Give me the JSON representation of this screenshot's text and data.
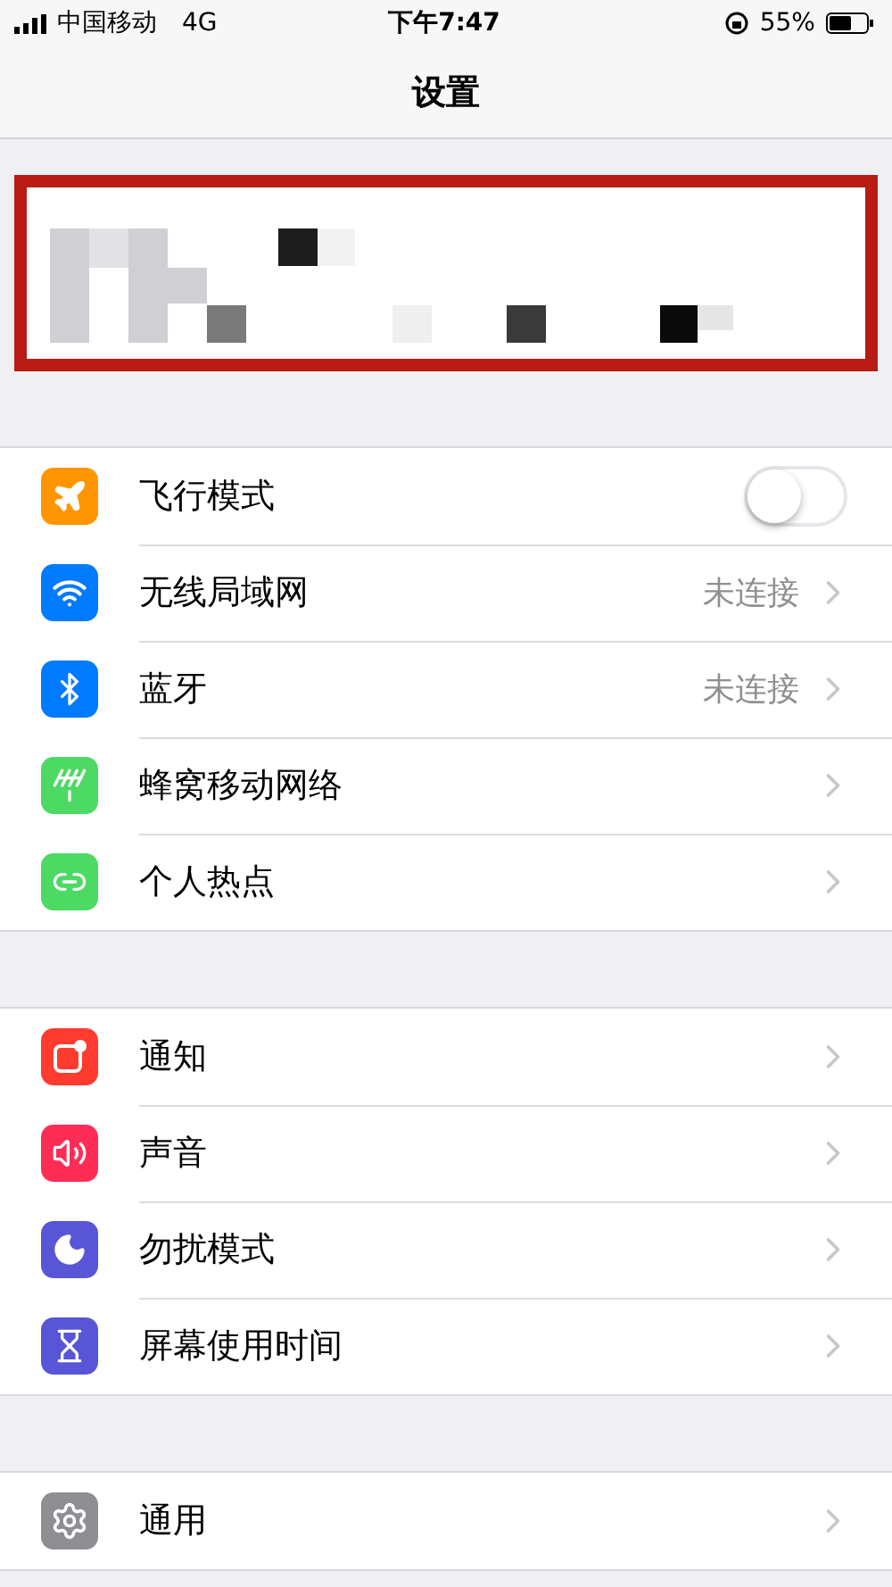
{
  "status_bar": {
    "carrier": "中国移动",
    "network": "4G",
    "time": "下午7:47",
    "battery": "55%"
  },
  "nav": {
    "title": "设置"
  },
  "profile": {
    "kind": "picture",
    "highlighted": true
  },
  "groups": [
    {
      "rows": [
        {
          "label": "飞行模式",
          "color": "#ff9500",
          "kind": "toggle",
          "on": false
        },
        {
          "label": "无线局域网",
          "color": "#007aff",
          "kind": "link",
          "value": "未连接"
        },
        {
          "label": "蓝牙",
          "color": "#007aff",
          "kind": "link",
          "value": "未连接"
        },
        {
          "label": "蜂窝移动网络",
          "color": "#4cd964",
          "kind": "link"
        },
        {
          "label": "个人热点",
          "color": "#4cd964",
          "kind": "link"
        }
      ]
    },
    {
      "rows": [
        {
          "label": "通知",
          "color": "#ff3b30",
          "kind": "link"
        },
        {
          "label": "声音",
          "color": "#ff2d55",
          "kind": "link"
        },
        {
          "label": "勿扰模式",
          "color": "#5856d6",
          "kind": "link"
        },
        {
          "label": "屏幕使用时间",
          "color": "#5856d6",
          "kind": "link"
        }
      ]
    },
    {
      "rows": [
        {
          "label": "通用",
          "color": "#8e8e93",
          "kind": "link"
        }
      ]
    }
  ]
}
